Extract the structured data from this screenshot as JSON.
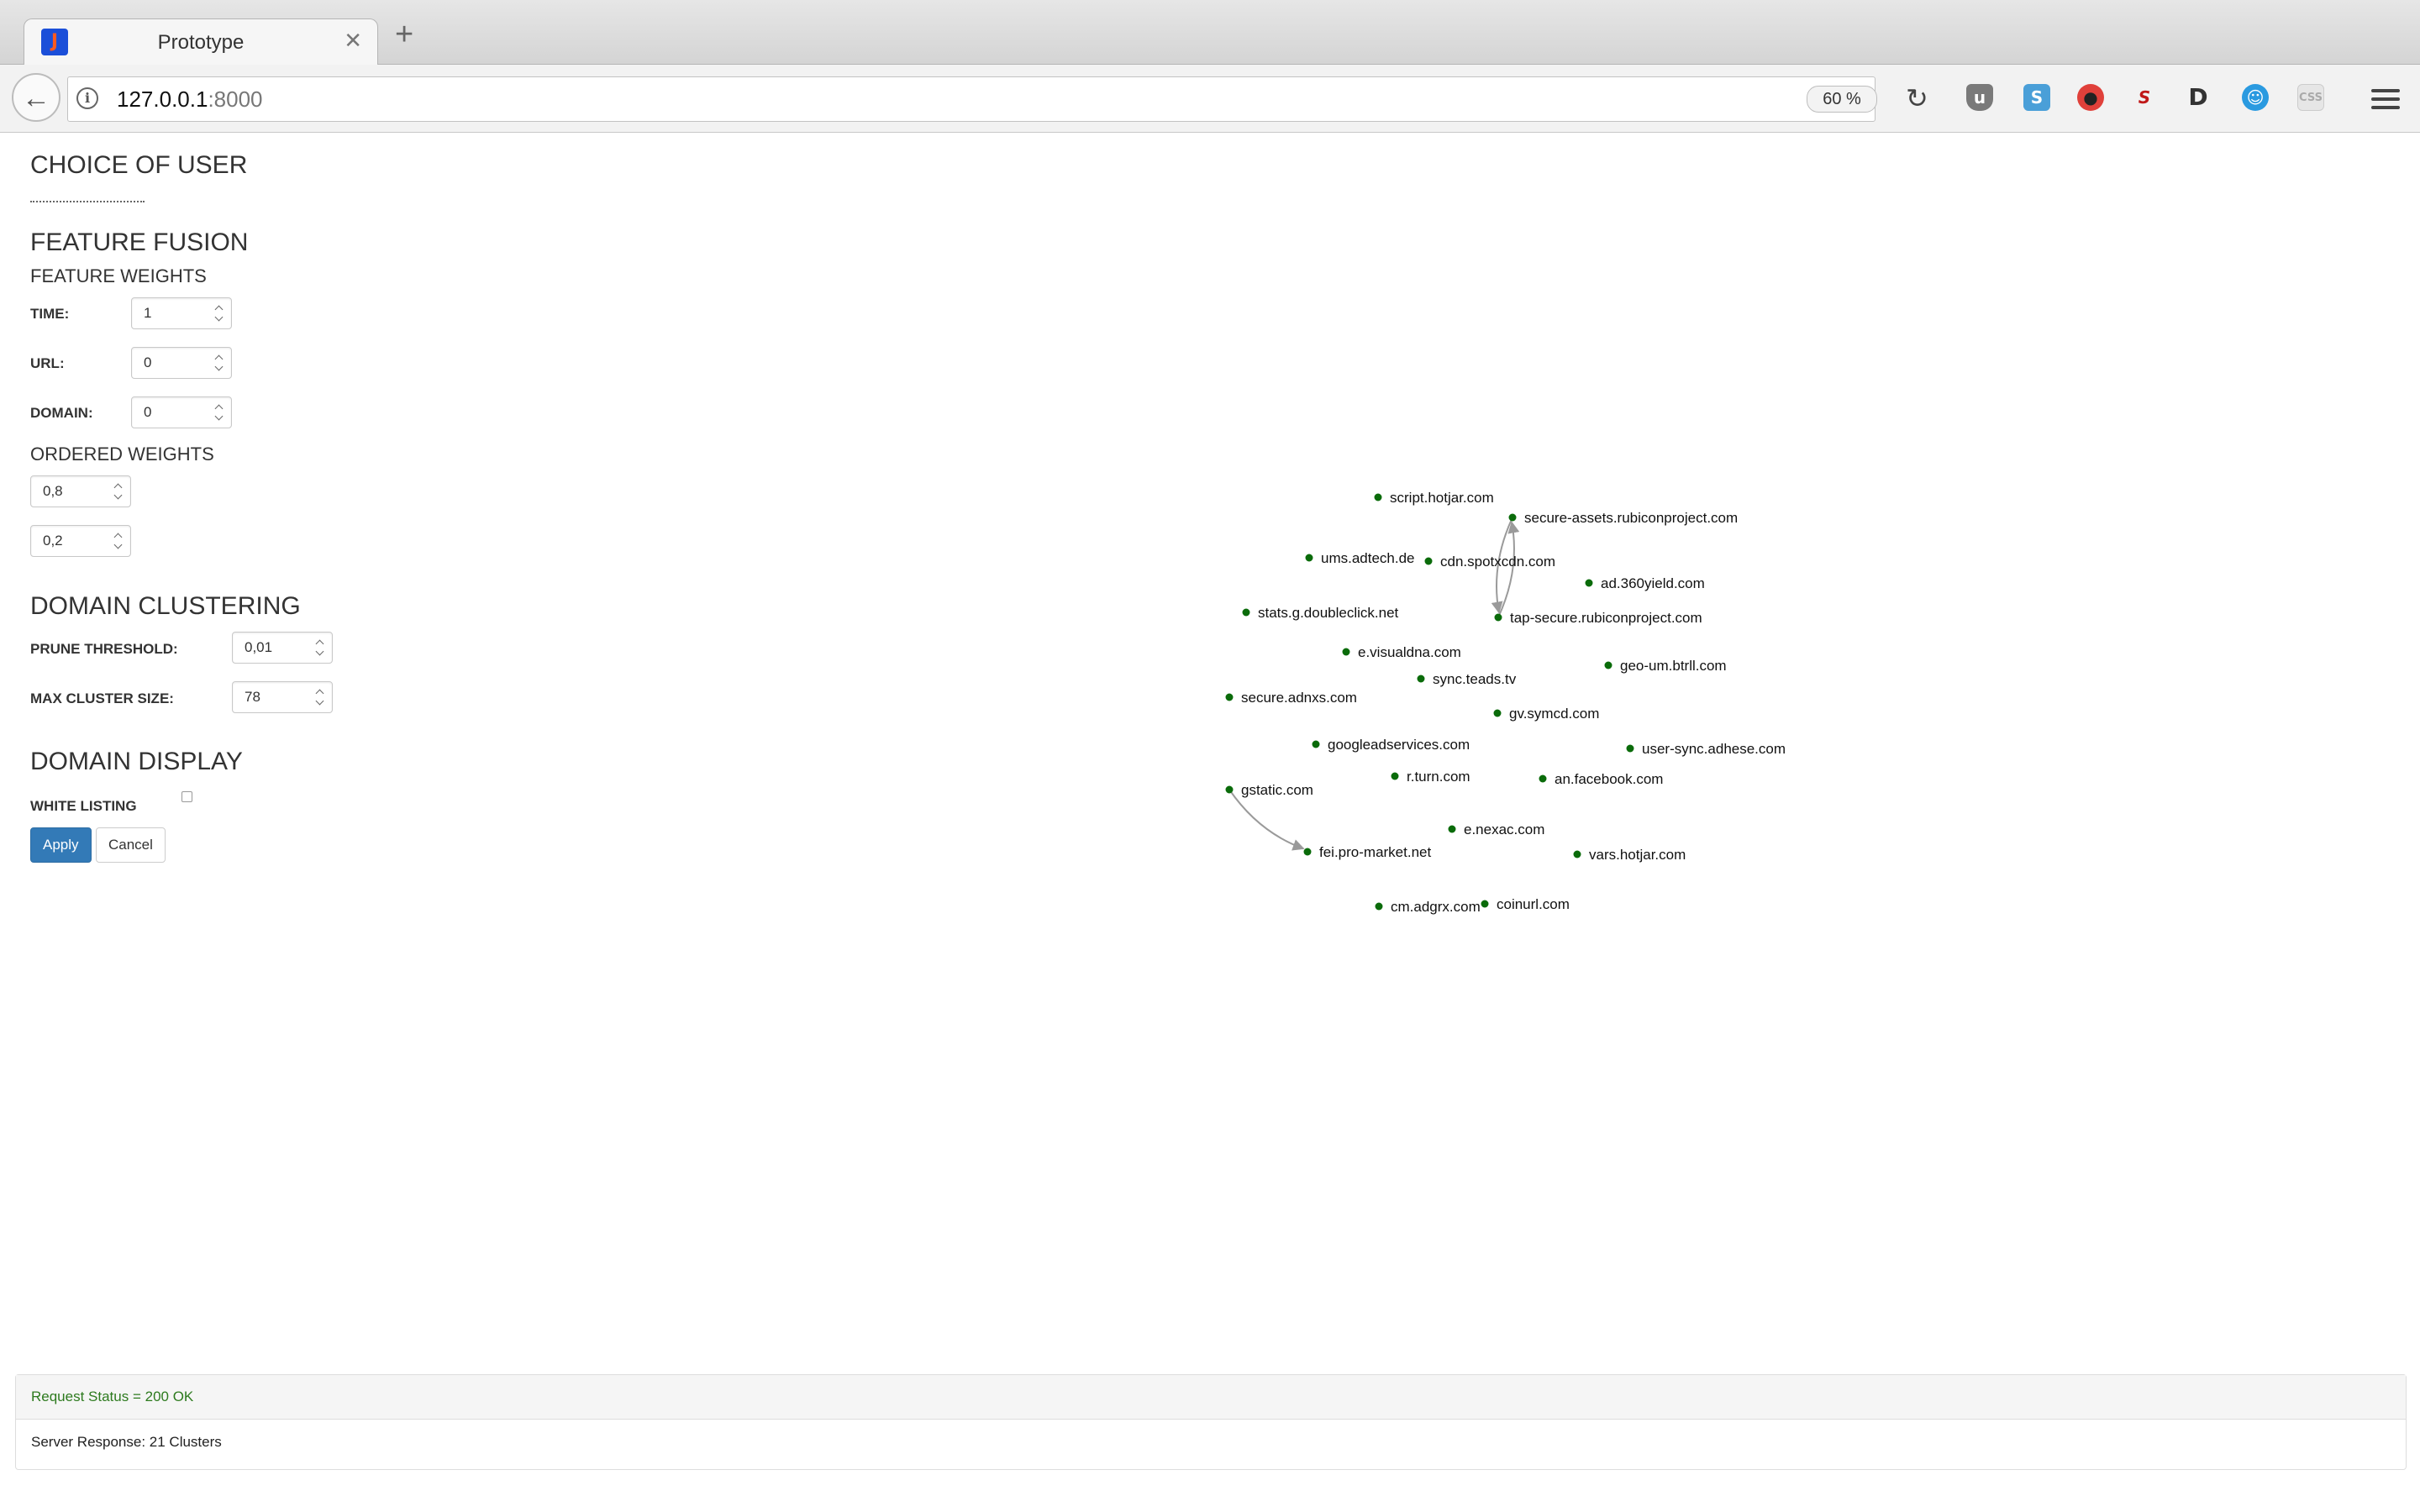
{
  "browser": {
    "tab_title": "Prototype",
    "tab_close": "✕",
    "new_tab": "+",
    "url_host": "127.0.0.1",
    "url_port": ":8000",
    "zoom": "60 %"
  },
  "sections": {
    "choice_of_user": "CHOICE OF USER",
    "feature_fusion": "FEATURE FUSION",
    "feature_weights": "FEATURE WEIGHTS",
    "ordered_weights": "ORDERED WEIGHTS",
    "domain_clustering": "DOMAIN CLUSTERING",
    "domain_display": "DOMAIN DISPLAY"
  },
  "fields": {
    "time_label": "TIME:",
    "time_value": "1",
    "url_label": "URL:",
    "url_value": "0",
    "domain_label": "DOMAIN:",
    "domain_value": "0",
    "ordered_weight_1": "0,8",
    "ordered_weight_2": "0,2",
    "prune_threshold_label": "PRUNE THRESHOLD:",
    "prune_threshold_value": "0,01",
    "max_cluster_size_label": "MAX CLUSTER SIZE:",
    "max_cluster_size_value": "78",
    "white_listing_label": "WHITE LISTING",
    "white_listing_checked": false
  },
  "buttons": {
    "apply": "Apply",
    "cancel": "Cancel"
  },
  "graph": {
    "nodes": [
      {
        "id": "script.hotjar.com",
        "label": "script.hotjar.com"
      },
      {
        "id": "secure-assets.rubiconproject.com",
        "label": "secure-assets.rubiconproject.com"
      },
      {
        "id": "ums.adtech.de",
        "label": "ums.adtech.de"
      },
      {
        "id": "cdn.spotxcdn.com",
        "label": "cdn.spotxcdn.com"
      },
      {
        "id": "ad.360yield.com",
        "label": "ad.360yield.com"
      },
      {
        "id": "stats.g.doubleclick.net",
        "label": "stats.g.doubleclick.net"
      },
      {
        "id": "tap-secure.rubiconproject.com",
        "label": "tap-secure.rubiconproject.com"
      },
      {
        "id": "e.visualdna.com",
        "label": "e.visualdna.com"
      },
      {
        "id": "geo-um.btrll.com",
        "label": "geo-um.btrll.com"
      },
      {
        "id": "sync.teads.tv",
        "label": "sync.teads.tv"
      },
      {
        "id": "secure.adnxs.com",
        "label": "secure.adnxs.com"
      },
      {
        "id": "gv.symcd.com",
        "label": "gv.symcd.com"
      },
      {
        "id": "googleadservices.com",
        "label": "googleadservices.com"
      },
      {
        "id": "user-sync.adhese.com",
        "label": "user-sync.adhese.com"
      },
      {
        "id": "r.turn.com",
        "label": "r.turn.com"
      },
      {
        "id": "an.facebook.com",
        "label": "an.facebook.com"
      },
      {
        "id": "gstatic.com",
        "label": "gstatic.com"
      },
      {
        "id": "e.nexac.com",
        "label": "e.nexac.com"
      },
      {
        "id": "fei.pro-market.net",
        "label": "fei.pro-market.net"
      },
      {
        "id": "vars.hotjar.com",
        "label": "vars.hotjar.com"
      },
      {
        "id": "cm.adgrx.com",
        "label": "cm.adgrx.com"
      },
      {
        "id": "coinurl.com",
        "label": "coinurl.com"
      }
    ],
    "edges": [
      {
        "source": "tap-secure.rubiconproject.com",
        "target": "secure-assets.rubiconproject.com"
      },
      {
        "source": "secure-assets.rubiconproject.com",
        "target": "tap-secure.rubiconproject.com"
      },
      {
        "source": "gstatic.com",
        "target": "fei.pro-market.net"
      }
    ],
    "node_color": "#0a6b0a",
    "edge_color": "#9a9a9a"
  },
  "status": {
    "request": "Request Status = 200 OK",
    "response": "Server Response: 21 Clusters"
  },
  "extensions": [
    "ublock-icon",
    "s-extension-icon",
    "red-extension-icon",
    "sj-extension-icon",
    "d-extension-icon",
    "profile-icon",
    "css-icon"
  ]
}
